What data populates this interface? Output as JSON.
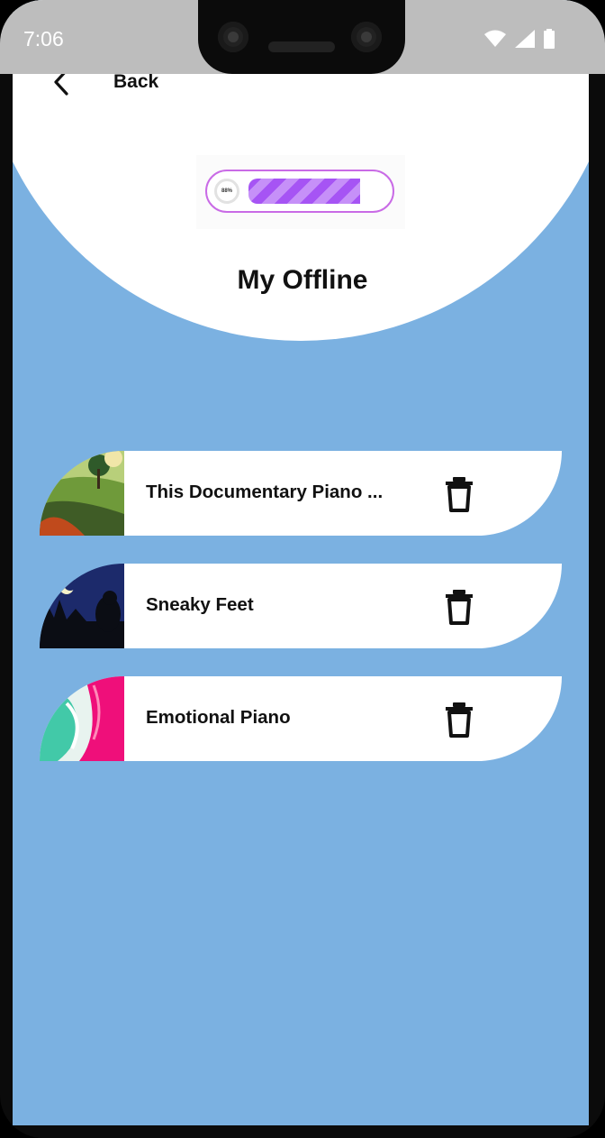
{
  "status": {
    "time": "7:06",
    "icons": [
      "wifi-icon",
      "signal-icon",
      "battery-icon"
    ]
  },
  "header": {
    "back_label": "Back",
    "title": "My Offline"
  },
  "progress": {
    "percent_label": "88%",
    "value": 0.88
  },
  "tracks": [
    {
      "title": "This Documentary Piano ...",
      "art": "landscape"
    },
    {
      "title": "Sneaky Feet",
      "art": "night"
    },
    {
      "title": "Emotional Piano",
      "art": "fluid"
    }
  ],
  "colors": {
    "background": "#7bb1e1",
    "accent": "#a654f4",
    "card": "#ffffff"
  }
}
